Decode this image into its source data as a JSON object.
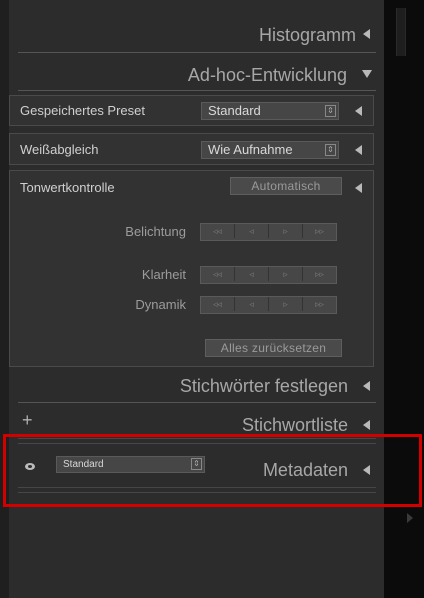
{
  "sections": {
    "histogramm": "Histogramm",
    "adhoc": "Ad-hoc-Entwicklung",
    "stichwoerter": "Stichwörter festlegen",
    "stichwortliste": "Stichwortliste",
    "metadaten": "Metadaten"
  },
  "adhoc": {
    "preset_label": "Gespeichertes Preset",
    "preset_value": "Standard",
    "wb_label": "Weißabgleich",
    "wb_value": "Wie Aufnahme",
    "tone_label": "Tonwertkontrolle",
    "auto_button": "Automatisch",
    "exposure_label": "Belichtung",
    "clarity_label": "Klarheit",
    "vibrance_label": "Dynamik",
    "reset_button": "Alles zurücksetzen",
    "stepper": [
      "◃◃",
      "◃",
      "▹",
      "▹▹"
    ]
  },
  "keywordlist": {
    "add_symbol": "+"
  },
  "metadata": {
    "preset_value": "Standard"
  },
  "icons": {
    "collapsed": "triangle-left-icon",
    "expanded": "triangle-down-icon",
    "visibility": "eye-icon"
  },
  "colors": {
    "highlight": "#d40000",
    "panel": "#2c2c2c",
    "header_text": "#a7a7a7"
  }
}
